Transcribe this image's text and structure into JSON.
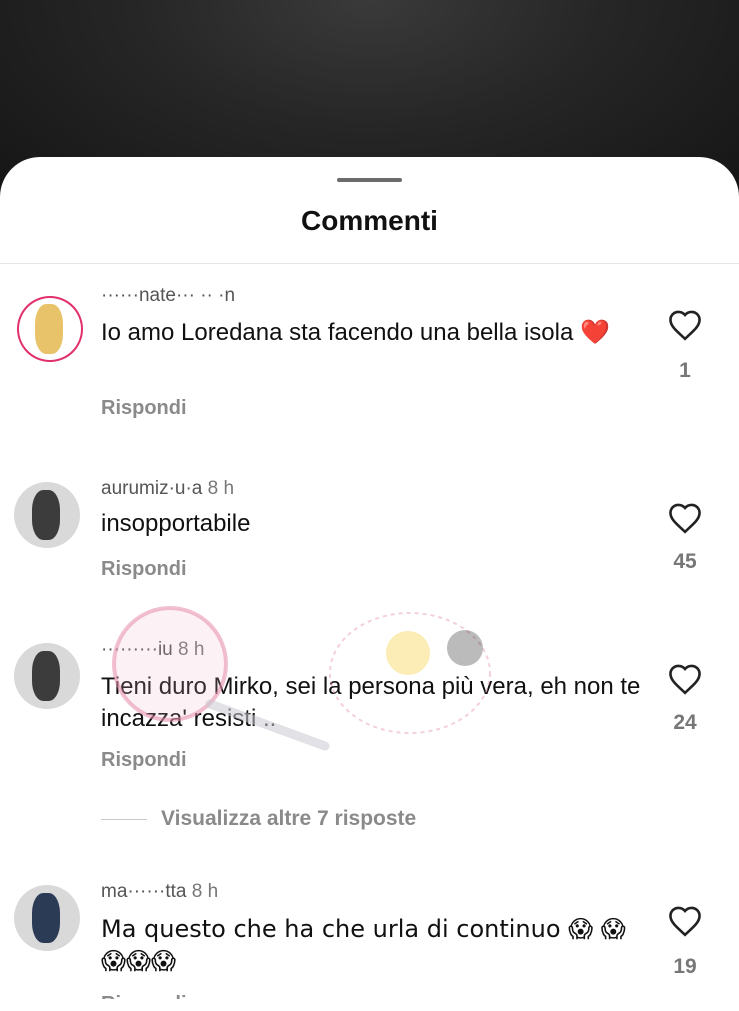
{
  "sheet": {
    "title": "Commenti"
  },
  "comments": [
    {
      "username": "······nate··· ·· ·n",
      "time": "",
      "text": "Io amo Loredana sta facendo una bella isola ❤️",
      "reply_label": "Rispondi",
      "likes": "1"
    },
    {
      "username": "aurumiz·u·a",
      "time": "8 h",
      "text": "insopportabile",
      "reply_label": "Rispondi",
      "likes": "45"
    },
    {
      "username": "·········iu",
      "time": "8 h",
      "text": "Tieni duro Mirko, sei la persona più vera, eh non te incazza' resisti ..",
      "reply_label": "Rispondi",
      "likes": "24"
    },
    {
      "username": "ma······tta",
      "time": "8 h",
      "text": "Ma questo che ha che urla di continuo 😱 😱😱😱😱",
      "reply_label": "Rispondi",
      "likes": "19"
    }
  ],
  "more_replies": "Visualizza altre 7 risposte",
  "colors": {
    "accent_ring": "#e1306c",
    "heart_red": "#e0202a",
    "secondary_text": "#8a8a8a"
  },
  "icons": {
    "like": "heart-outline-icon"
  }
}
